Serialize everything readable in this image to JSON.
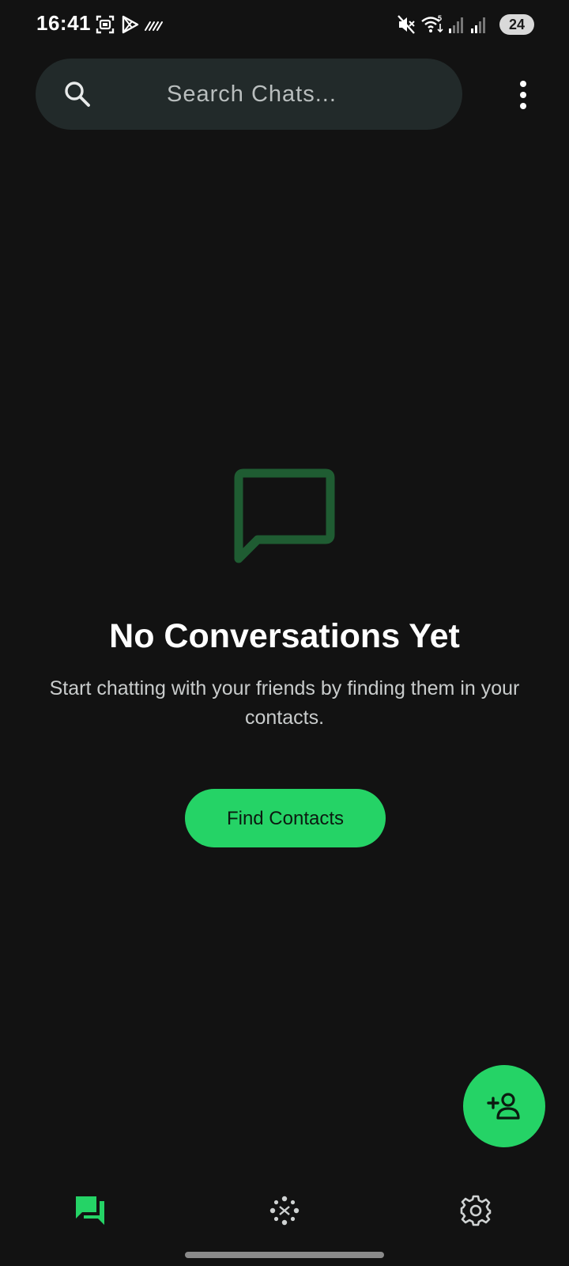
{
  "status_bar": {
    "time": "16:41",
    "battery": "24",
    "icons": [
      "screenshot-icon",
      "play-store-icon",
      "nfc-icon",
      "mute-icon",
      "wifi-icon",
      "signal-icon",
      "signal-icon"
    ]
  },
  "search": {
    "placeholder": "Search Chats...",
    "icon": "search-icon"
  },
  "menu": {
    "icon": "more-vert-icon"
  },
  "empty_state": {
    "icon": "chat-bubble-outline-icon",
    "title": "No Conversations Yet",
    "subtitle": "Start chatting with your friends by finding them in your contacts.",
    "button_label": "Find Contacts"
  },
  "fab": {
    "icon": "person-add-icon"
  },
  "bottom_nav": {
    "items": [
      {
        "name": "chats",
        "icon": "chats-icon",
        "active": true
      },
      {
        "name": "updates",
        "icon": "updates-icon",
        "active": false
      },
      {
        "name": "settings",
        "icon": "gear-icon",
        "active": false
      }
    ]
  },
  "colors": {
    "background": "#121212",
    "accent": "#25d366",
    "empty_icon": "#1f5c32",
    "search_bg": "#222a2a"
  }
}
